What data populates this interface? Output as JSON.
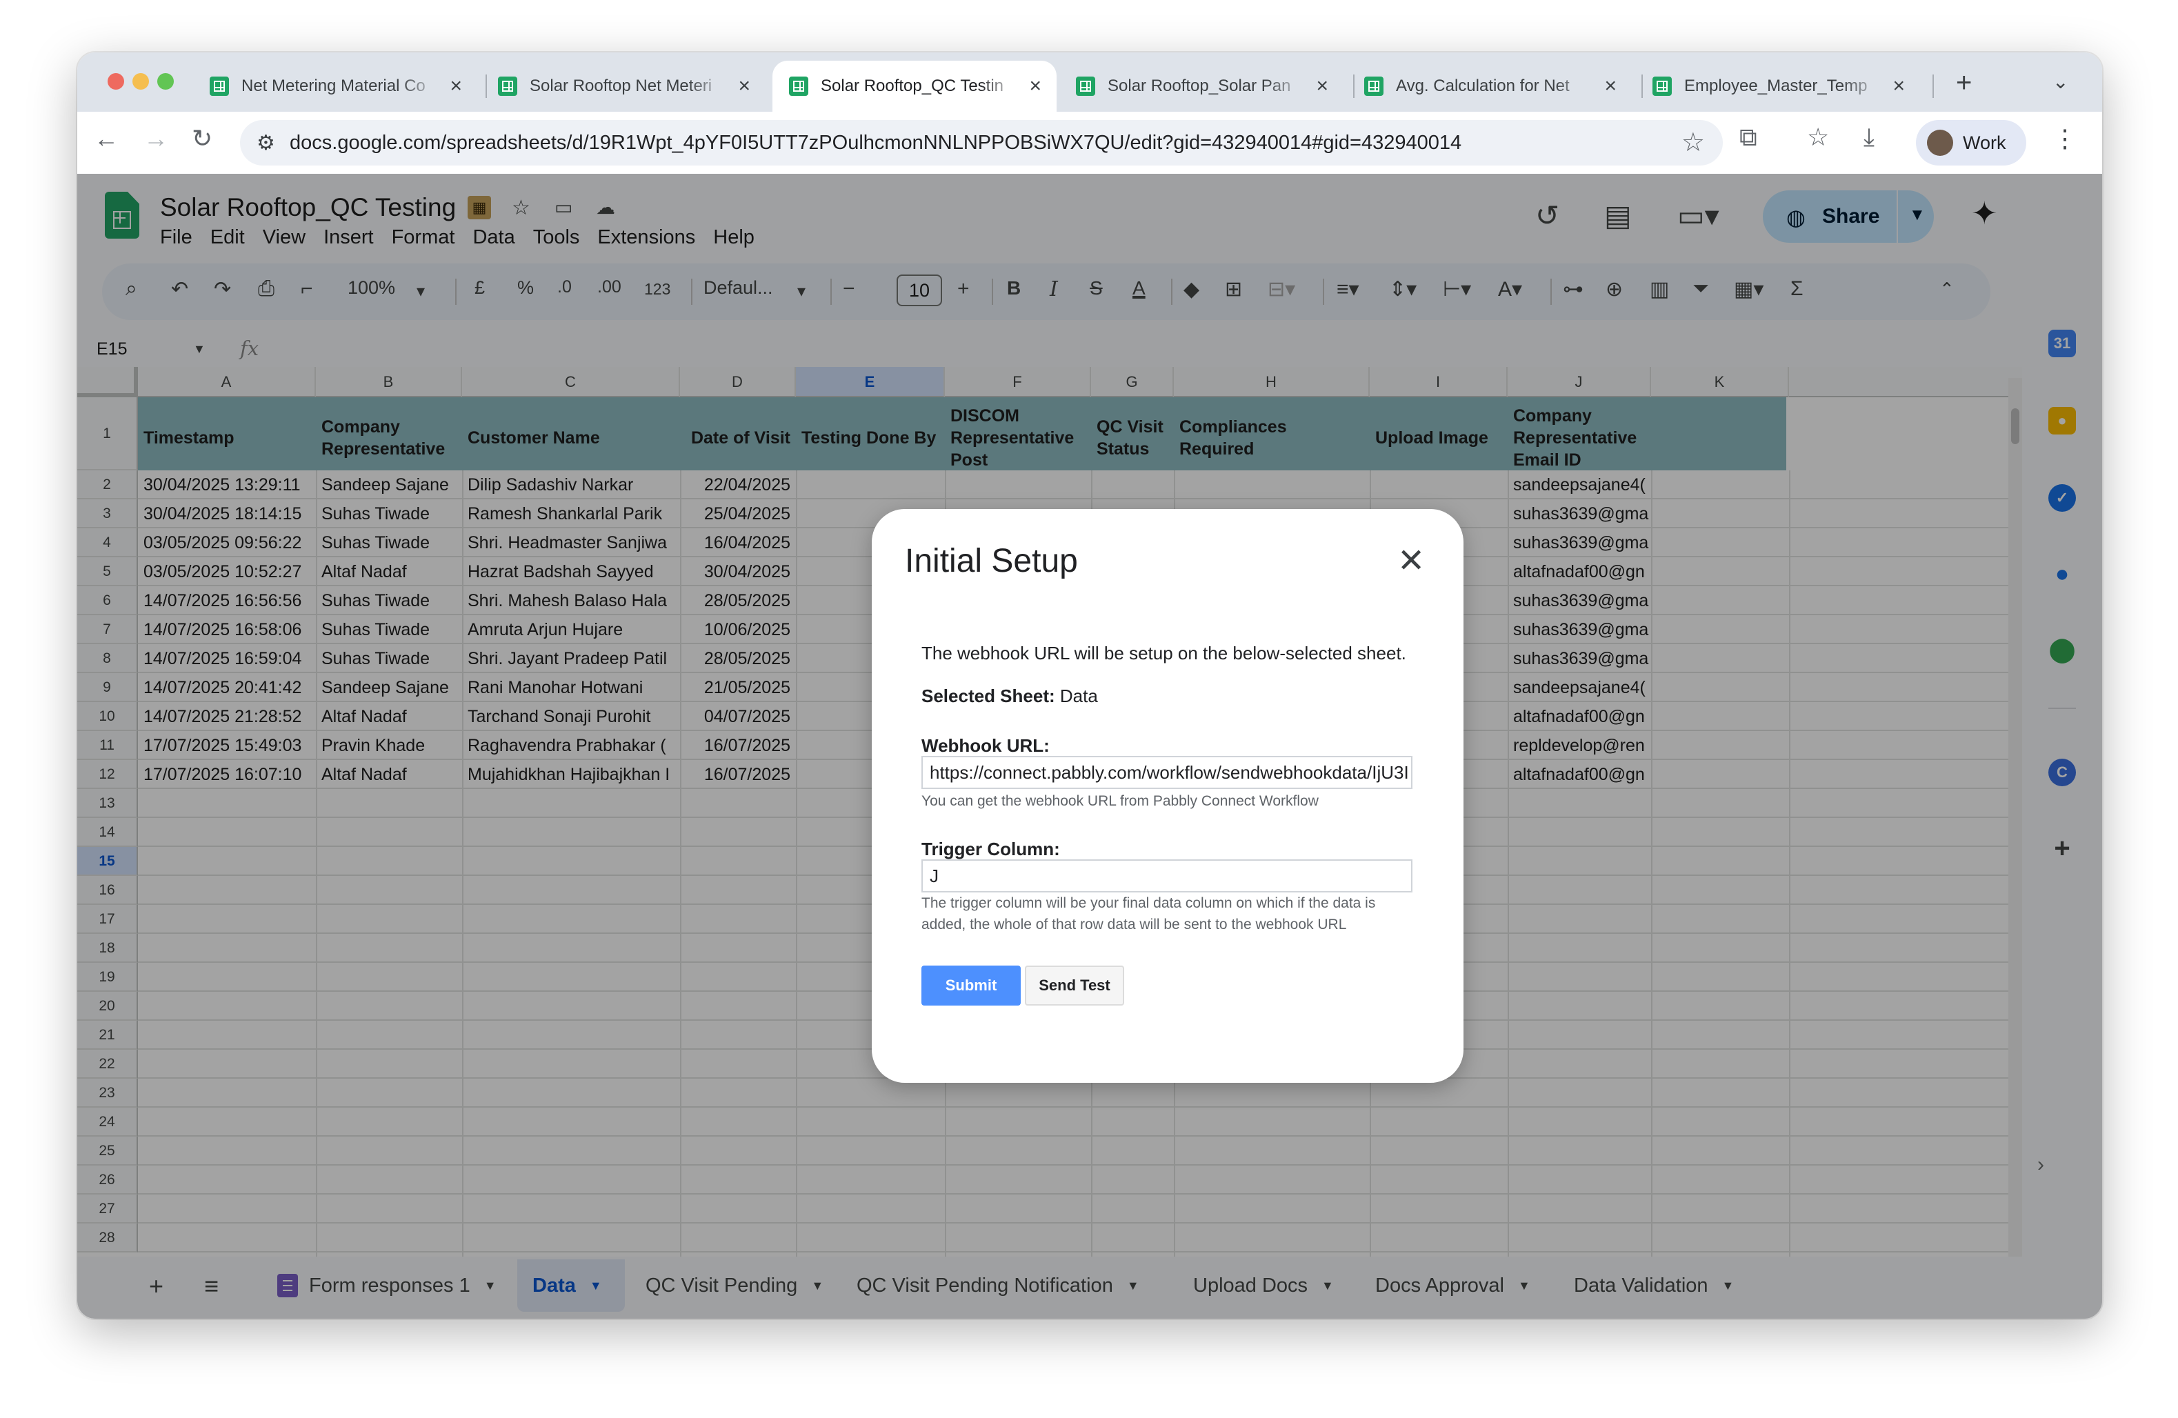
{
  "browser": {
    "tabs": [
      {
        "title": "Net Metering Material Co"
      },
      {
        "title": "Solar Rooftop Net Meteri"
      },
      {
        "title": "Solar Rooftop_QC Testin",
        "active": true
      },
      {
        "title": "Solar Rooftop_Solar Pan"
      },
      {
        "title": "Avg. Calculation for Net"
      },
      {
        "title": "Employee_Master_Temp"
      }
    ],
    "url": "docs.google.com/spreadsheets/d/19R1Wpt_4pYF0I5UTT7zPOulhcmonNNLNPPOBSiWX7QU/edit?gid=432940014#gid=432940014",
    "profile_label": "Work"
  },
  "doc": {
    "title": "Solar Rooftop_QC Testing",
    "menus": [
      "File",
      "Edit",
      "View",
      "Insert",
      "Format",
      "Data",
      "Tools",
      "Extensions",
      "Help"
    ],
    "share_label": "Share"
  },
  "format_toolbar": {
    "zoom": "100%",
    "currency": "£",
    "percent": "%",
    "dec_minus": ".0",
    "dec_plus": ".00",
    "number_format": "123",
    "font": "Defaul...",
    "font_size": "10"
  },
  "formula_bar": {
    "name_box": "E15",
    "fx": "fx"
  },
  "grid": {
    "columns": [
      "A",
      "B",
      "C",
      "D",
      "E",
      "F",
      "G",
      "H",
      "I",
      "J",
      "K"
    ],
    "selected_column": "E",
    "selected_row": "15",
    "row_numbers": [
      "1",
      "2",
      "3",
      "4",
      "5",
      "6",
      "7",
      "8",
      "9",
      "10",
      "11",
      "12",
      "13",
      "14",
      "15",
      "16",
      "17",
      "18",
      "19",
      "20",
      "21",
      "22",
      "23",
      "24",
      "25",
      "26",
      "27",
      "28"
    ],
    "headers": [
      "Timestamp",
      "Company Representative",
      "Customer Name",
      "Date of Visit",
      "Testing Done By",
      "DISCOM Representative Post",
      "QC Visit Status",
      "Compliances Required",
      "Upload Image",
      "Company Representative Email ID"
    ],
    "header_fill": "#8fbcc3",
    "rows": [
      {
        "timestamp": "30/04/2025 13:29:11",
        "rep": "Sandeep Sajane",
        "customer": "Dilip Sadashiv Narkar",
        "date": "22/04/2025",
        "email": "sandeepsajane4("
      },
      {
        "timestamp": "30/04/2025 18:14:15",
        "rep": "Suhas Tiwade",
        "customer": "Ramesh Shankarlal Parik",
        "date": "25/04/2025",
        "email": "suhas3639@gma"
      },
      {
        "timestamp": "03/05/2025 09:56:22",
        "rep": "Suhas Tiwade",
        "customer": "Shri. Headmaster Sanjiwa",
        "date": "16/04/2025",
        "email": "suhas3639@gma"
      },
      {
        "timestamp": "03/05/2025 10:52:27",
        "rep": "Altaf Nadaf",
        "customer": "Hazrat Badshah Sayyed",
        "date": "30/04/2025",
        "email": "altafnadaf00@gn"
      },
      {
        "timestamp": "14/07/2025 16:56:56",
        "rep": "Suhas Tiwade",
        "customer": "Shri. Mahesh Balaso Hala",
        "date": "28/05/2025",
        "email": "suhas3639@gma"
      },
      {
        "timestamp": "14/07/2025 16:58:06",
        "rep": "Suhas Tiwade",
        "customer": "Amruta Arjun Hujare",
        "date": "10/06/2025",
        "email": "suhas3639@gma"
      },
      {
        "timestamp": "14/07/2025 16:59:04",
        "rep": "Suhas Tiwade",
        "customer": "Shri. Jayant Pradeep Patil",
        "date": "28/05/2025",
        "email": "suhas3639@gma"
      },
      {
        "timestamp": "14/07/2025 20:41:42",
        "rep": "Sandeep Sajane",
        "customer": "Rani Manohar Hotwani",
        "date": "21/05/2025",
        "email": "sandeepsajane4("
      },
      {
        "timestamp": "14/07/2025 21:28:52",
        "rep": "Altaf Nadaf",
        "customer": "Tarchand Sonaji Purohit",
        "date": "04/07/2025",
        "email": "altafnadaf00@gn"
      },
      {
        "timestamp": "17/07/2025 15:49:03",
        "rep": "Pravin Khade",
        "customer": "Raghavendra Prabhakar (",
        "date": "16/07/2025",
        "email": "repldevelop@ren"
      },
      {
        "timestamp": "17/07/2025 16:07:10",
        "rep": "Altaf Nadaf",
        "customer": "Mujahidkhan Hajibajkhan I",
        "date": "16/07/2025",
        "email": "altafnadaf00@gn"
      }
    ]
  },
  "sheet_tabs": [
    {
      "label": "Form responses 1"
    },
    {
      "label": "Data",
      "active": true
    },
    {
      "label": "QC Visit Pending"
    },
    {
      "label": "QC Visit Pending Notification"
    },
    {
      "label": "Upload Docs"
    },
    {
      "label": "Docs Approval"
    },
    {
      "label": "Data Validation"
    }
  ],
  "modal": {
    "title": "Initial Setup",
    "intro": "The webhook URL will be setup on the below-selected sheet.",
    "selected_sheet_label": "Selected Sheet:",
    "selected_sheet_value": "Data",
    "webhook_label": "Webhook URL:",
    "webhook_value": "https://connect.pabbly.com/workflow/sendwebhookdata/IjU3I",
    "webhook_help": "You can get the webhook URL from Pabbly Connect Workflow",
    "trigger_label": "Trigger Column:",
    "trigger_value": "J",
    "trigger_help": "The trigger column will be your final data column on which if the data is added, the whole of that row data will be sent to the webhook URL",
    "submit_label": "Submit",
    "send_test_label": "Send Test"
  }
}
